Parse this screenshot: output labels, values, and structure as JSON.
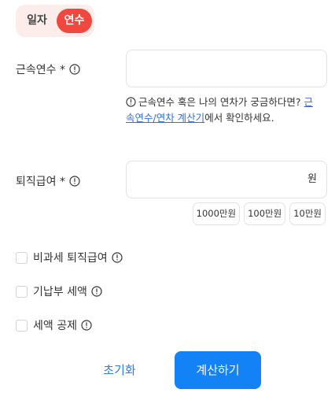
{
  "toggle": {
    "options": [
      {
        "label": "일자",
        "selected": false
      },
      {
        "label": "연수",
        "selected": true
      }
    ]
  },
  "years": {
    "label": "근속연수 *",
    "value": "",
    "placeholder": ""
  },
  "hint": {
    "prefix": "근속연수 혹은 나의 연차가 궁금하다면? ",
    "link": "근속연수/연차 계산기",
    "suffix": "에서 확인하세요."
  },
  "pay": {
    "label": "퇴직급여 *",
    "value": "",
    "unit": "원",
    "chips": [
      "1000만원",
      "100만원",
      "10만원"
    ]
  },
  "checks": [
    {
      "label": "비과세 퇴직급여",
      "checked": false
    },
    {
      "label": "기납부 세액",
      "checked": false
    },
    {
      "label": "세액 공제",
      "checked": false
    }
  ],
  "actions": {
    "reset": "초기화",
    "calculate": "계산하기"
  },
  "colors": {
    "accent_red": "#f0483e",
    "toggle_bg": "#fcecea",
    "primary_blue": "#1482f7",
    "link_blue": "#2d6fe0"
  },
  "icons": {
    "info": "info-circle-icon"
  }
}
